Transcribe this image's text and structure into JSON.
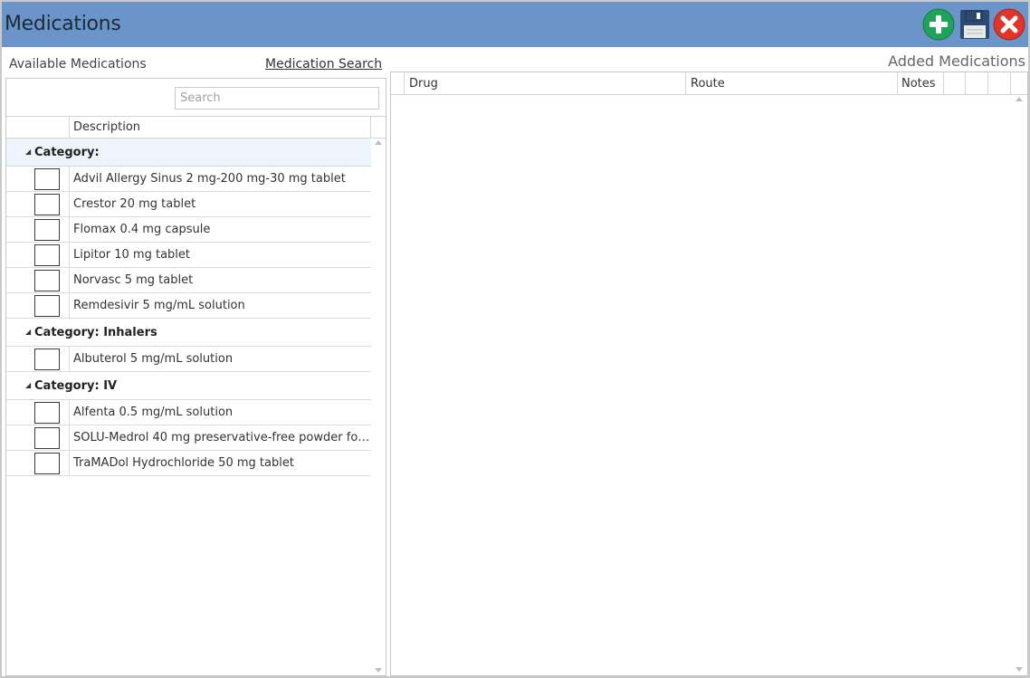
{
  "window": {
    "title": "Medications"
  },
  "toolbar": {
    "add_icon": "plus-circle-icon",
    "save_icon": "floppy-disk-icon",
    "close_icon": "close-circle-icon",
    "colors": {
      "titlebar": "#6b95c9",
      "add": "#1fa35a",
      "close": "#e0352b",
      "save": "#2d4a73"
    }
  },
  "left": {
    "label": "Available Medications",
    "search_link": "Medication Search",
    "search_placeholder": "Search",
    "column_description": "Description",
    "groups": [
      {
        "category": "Category:",
        "items": [
          "Advil Allergy Sinus 2 mg-200 mg-30 mg tablet",
          "Crestor 20 mg tablet",
          "Flomax 0.4 mg capsule",
          "Lipitor 10 mg tablet",
          "Norvasc 5 mg tablet",
          "Remdesivir 5 mg/mL solution"
        ]
      },
      {
        "category": "Category: Inhalers",
        "items": [
          "Albuterol 5 mg/mL solution"
        ]
      },
      {
        "category": "Category: IV",
        "items": [
          "Alfenta 0.5 mg/mL solution",
          "SOLU-Medrol 40 mg preservative-free powder for...",
          "TraMADol Hydrochloride 50 mg tablet"
        ]
      }
    ]
  },
  "right": {
    "label": "Added Medications",
    "columns": [
      "Drug",
      "Route",
      "Notes"
    ]
  }
}
